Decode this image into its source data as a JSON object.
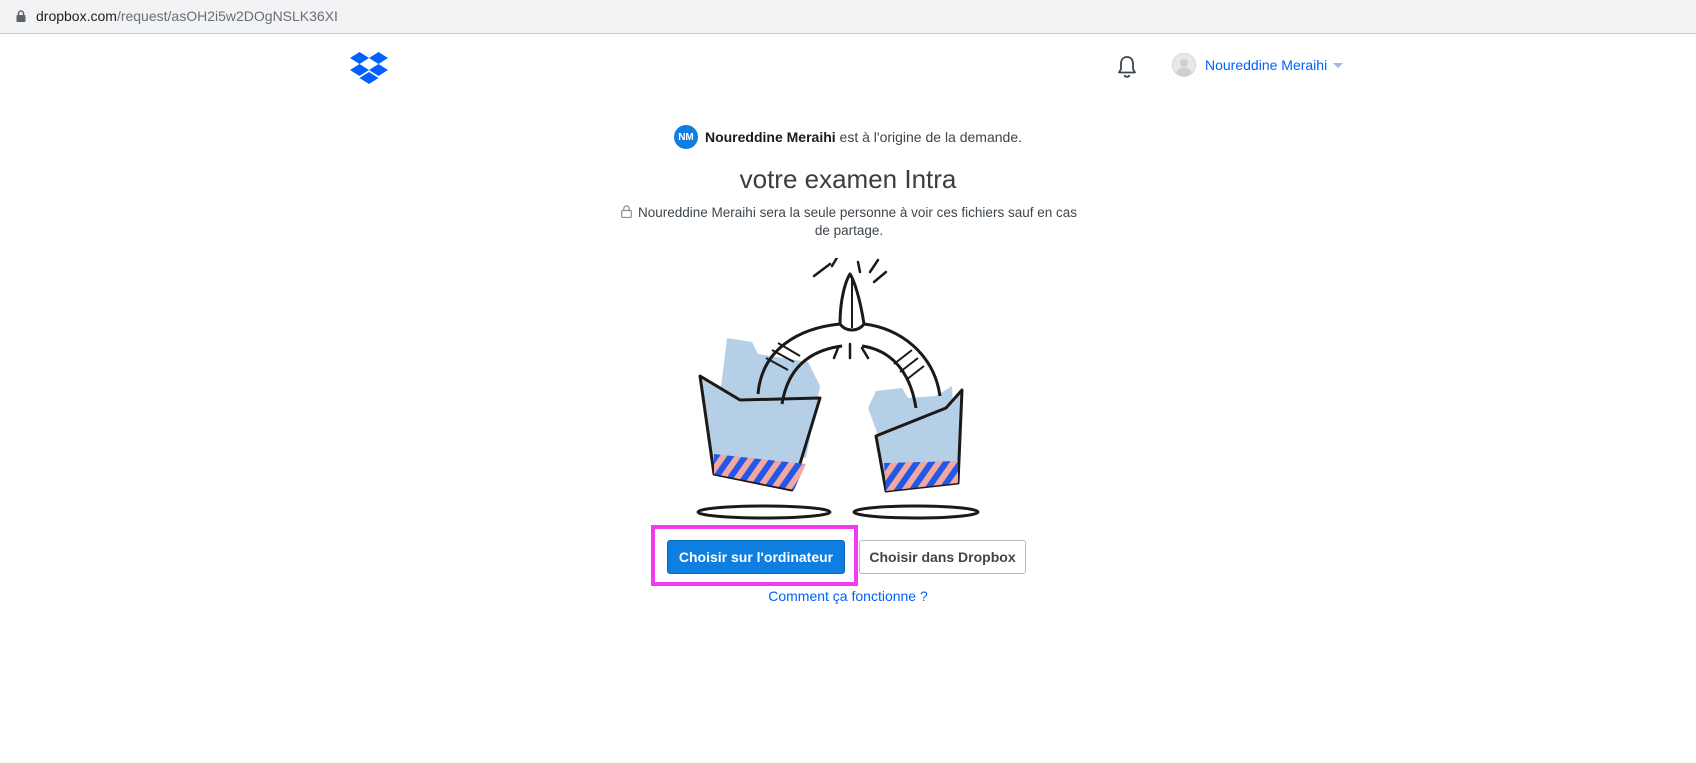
{
  "browser": {
    "url_host": "dropbox.com",
    "url_path": "/request/asOH2i5w2DOgNSLK36XI"
  },
  "header": {
    "logo_icon": "dropbox-logo-icon",
    "notifications_icon": "bell-icon",
    "account_name": "Noureddine Meraihi"
  },
  "request": {
    "requester_initials": "NM",
    "requester_name": "Noureddine Meraihi",
    "requester_suffix": " est à l'origine de la demande.",
    "title": "votre examen Intra",
    "privacy_note": "Noureddine Meraihi sera la seule personne à voir ces fichiers sauf en cas de partage."
  },
  "actions": {
    "upload_computer_label": "Choisir sur l'ordinateur",
    "upload_dropbox_label": "Choisir dans Dropbox",
    "help_link": "Comment ça fonctionne ?"
  },
  "colors": {
    "accent": "#0f7ee1",
    "link": "#0061fe",
    "highlight": "#f23af0"
  }
}
